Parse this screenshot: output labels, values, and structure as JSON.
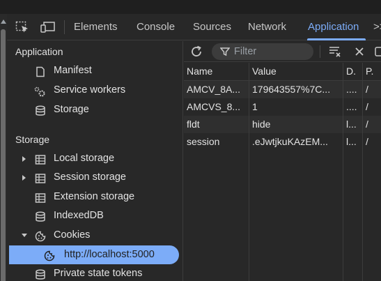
{
  "tabs": [
    {
      "label": "Elements",
      "active": false
    },
    {
      "label": "Console",
      "active": false
    },
    {
      "label": "Sources",
      "active": false
    },
    {
      "label": "Network",
      "active": false
    },
    {
      "label": "Application",
      "active": true
    }
  ],
  "more_tabs": ">>",
  "sidebar": {
    "application_header": "Application",
    "application_items": [
      {
        "label": "Manifest",
        "icon": "document-icon"
      },
      {
        "label": "Service workers",
        "icon": "gears-icon"
      },
      {
        "label": "Storage",
        "icon": "database-icon"
      }
    ],
    "storage_header": "Storage",
    "storage_items": [
      {
        "label": "Local storage",
        "icon": "table-icon",
        "expandable": true
      },
      {
        "label": "Session storage",
        "icon": "table-icon",
        "expandable": true
      },
      {
        "label": "Extension storage",
        "icon": "table-icon"
      },
      {
        "label": "IndexedDB",
        "icon": "database-icon"
      },
      {
        "label": "Cookies",
        "icon": "cookie-icon",
        "expanded": true
      },
      {
        "label": "http://localhost:5000",
        "icon": "cookie-icon",
        "selected": true
      },
      {
        "label": "Private state tokens",
        "icon": "database-icon"
      }
    ]
  },
  "toolbar": {
    "filter_placeholder": "Filter"
  },
  "cookie_table": {
    "columns": [
      "Name",
      "Value",
      "D.",
      "P."
    ],
    "rows": [
      [
        "AMCV_8A...",
        "179643557%7C...",
        "....",
        "/"
      ],
      [
        "AMCVS_8...",
        "1",
        "....",
        "/"
      ],
      [
        "fldt",
        "hide",
        "l...",
        "/"
      ],
      [
        "session",
        ".eJwtjkuKAzEM...",
        "l...",
        "/"
      ]
    ]
  },
  "colors": {
    "accent": "#7cacf8",
    "background": "#282828",
    "border": "#3c3c3c"
  }
}
